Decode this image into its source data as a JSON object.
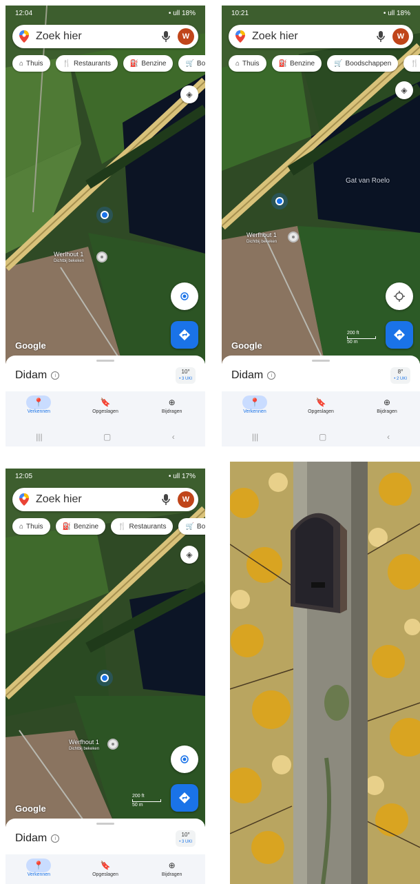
{
  "search": {
    "placeholder": "Zoek hier",
    "avatar_letter": "W"
  },
  "google_label": "Google",
  "panels": [
    {
      "status": {
        "time": "12:04",
        "right": "• ull 18%"
      },
      "chips": [
        {
          "icon": "home-icon",
          "label": "Thuis"
        },
        {
          "icon": "restaurant-icon",
          "label": "Restaurants"
        },
        {
          "icon": "gas-icon",
          "label": "Benzine"
        },
        {
          "icon": "cart-icon",
          "label": "Bo"
        }
      ],
      "place": {
        "name": "Werlhout 1",
        "sub": "Dichtbij bekeken"
      },
      "city": "Didam",
      "weather": {
        "temp": "10°",
        "aq": "• 3 UKI"
      },
      "nav": [
        "Verkennen",
        "Opgeslagen",
        "Bijdragen"
      ]
    },
    {
      "status": {
        "time": "10:21",
        "right": "• ull 18%"
      },
      "chips": [
        {
          "icon": "home-icon",
          "label": "Thuis"
        },
        {
          "icon": "gas-icon",
          "label": "Benzine"
        },
        {
          "icon": "cart-icon",
          "label": "Boodschappen"
        },
        {
          "icon": "restaurant-icon",
          "label": ""
        }
      ],
      "map_label": "Gat van Roelo",
      "place": {
        "name": "Werfhout 1",
        "sub": "Dichtbij bekeken"
      },
      "scale": {
        "top": "200 ft",
        "bottom": "50 m"
      },
      "city": "Didam",
      "weather": {
        "temp": "8°",
        "aq": "• 2 UKI"
      },
      "nav": [
        "Verkennen",
        "Opgeslagen",
        "Bijdragen"
      ]
    },
    {
      "status": {
        "time": "12:05",
        "right": "• ull 17%"
      },
      "chips": [
        {
          "icon": "home-icon",
          "label": "Thuis"
        },
        {
          "icon": "gas-icon",
          "label": "Benzine"
        },
        {
          "icon": "restaurant-icon",
          "label": "Restaurants"
        },
        {
          "icon": "cart-icon",
          "label": "Bo"
        }
      ],
      "place": {
        "name": "Werfhout 1",
        "sub": "Dichtbij bekeken"
      },
      "scale": {
        "top": "200 ft",
        "bottom": "50 m"
      },
      "city": "Didam",
      "weather": {
        "temp": "10°",
        "aq": "• 3 UKI"
      },
      "nav": [
        "Verkennen",
        "Opgeslagen",
        "Bijdragen"
      ]
    }
  ],
  "colors": {
    "accent": "#1a73e8",
    "avatar": "#c0451a",
    "road": "#d9c27a"
  }
}
